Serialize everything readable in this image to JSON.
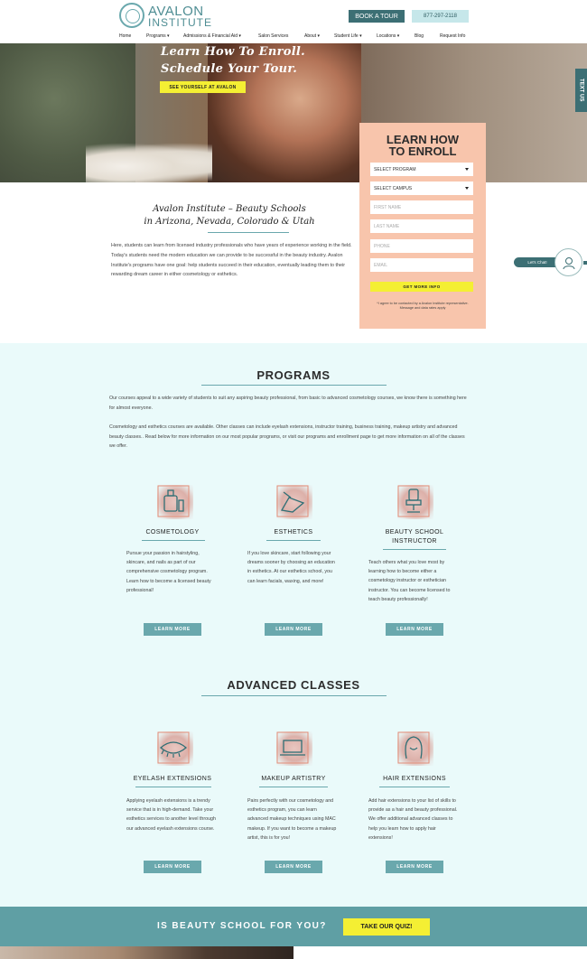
{
  "header": {
    "logo_line1": "AVALON",
    "logo_line2": "INSTITUTE",
    "book_tour": "BOOK A TOUR",
    "phone": "877-297-2118"
  },
  "nav": {
    "items": [
      "Home",
      "Programs ▾",
      "Admissions & Financial Aid ▾",
      "Salon Services",
      "About ▾",
      "Student Life ▾",
      "Locations ▾",
      "Blog",
      "Request Info"
    ]
  },
  "hero": {
    "line1": "Learn How To Enroll.",
    "line2": "Schedule Your Tour.",
    "button": "SEE YOURSELF AT AVALON",
    "text_us": "TEXT US"
  },
  "form": {
    "title_line1": "LEARN HOW",
    "title_line2": "TO ENROLL",
    "program": "SELECT PROGRAM",
    "campus": "SELECT CAMPUS",
    "first_name": "FIRST NAME",
    "last_name": "LAST NAME",
    "phone": "PHONE",
    "email": "EMAIL",
    "submit": "GET MORE INFO",
    "fine_print": "*I agree to be contacted by a Avalon Institute representative. Message and data rates apply"
  },
  "intro": {
    "title_line1": "Avalon Institute – Beauty Schools",
    "title_line2": "in Arizona, Nevada, Colorado & Utah",
    "body": "Here, students can learn from licensed industry professionals who have years of experience working in the field. Today's students need the modern education we can provide to be successful in the beauty industry. Avalon Institute's programs have one goal: help students succeed in their education, eventually leading them to their rewarding dream career in either cosmetology or esthetics."
  },
  "chat": {
    "label": "Let's Chat!"
  },
  "programs": {
    "title": "PROGRAMS",
    "para1": "Our courses appeal to a wide variety of students to suit any aspiring beauty professional, from basic to advanced cosmetology courses, we know there is something here for almost everyone.",
    "para2": "Cosmetology and esthetics courses are available. Other classes can include eyelash extensions, instructor training, business training, makeup artistry and advanced beauty classes.. Read below for more information on our most popular programs, or visit our programs and enrollment page to get more information on all of the classes we offer.",
    "cards": [
      {
        "label": "COSMETOLOGY",
        "label2": "",
        "text": "Pursue your passion in hairstyling, skincare, and nails as part of our comprehensive cosmetology program. Learn how to become a licensed beauty professional!",
        "button": "LEARN MORE",
        "icon": "cosmetology-icon"
      },
      {
        "label": "ESTHETICS",
        "label2": "",
        "text": "If you love skincare, start following your dreams sooner by choosing an education in esthetics. At our esthetics school, you can learn facials, waxing, and more!",
        "button": "LEARN MORE",
        "icon": "esthetics-icon"
      },
      {
        "label": "BEAUTY SCHOOL",
        "label2": "INSTRUCTOR",
        "text": "Teach others what you love most by learning how to become either a cosmetology instructor or esthetician instructor. You can become licensed to teach beauty professionally!",
        "button": "LEARN MORE",
        "icon": "salon-chair-icon"
      }
    ]
  },
  "advanced": {
    "title": "ADVANCED CLASSES",
    "cards": [
      {
        "label": "EYELASH EXTENSIONS",
        "text": "Applying eyelash extensions is a trendy service that is in high-demand. Take your esthetics services to another level through our advanced eyelash extensions course.",
        "button": "LEARN MORE",
        "icon": "eyelash-icon"
      },
      {
        "label": "MAKEUP ARTISTRY",
        "text": "Pairs perfectly with our cosmetology and esthetics program, you can learn advanced makeup techniques using MAC makeup. If you want to become a makeup artist, this is for you!",
        "button": "LEARN MORE",
        "icon": "makeup-laptop-icon"
      },
      {
        "label": "HAIR EXTENSIONS",
        "text": "Add hair extensions to your list of skills to provide as a hair and beauty professional. We offer additional advanced classes to help you learn how to apply hair extensions!",
        "button": "LEARN MORE",
        "icon": "hair-icon"
      }
    ]
  },
  "quiz": {
    "text": "IS BEAUTY SCHOOL FOR YOU?",
    "button": "TAKE OUR QUIZ!"
  },
  "colors": {
    "teal_dark": "#3c6f74",
    "teal": "#6aa8ad",
    "yellow": "#f4ef33",
    "peach": "#f8c5ac",
    "section_bg": "#eafafa"
  }
}
